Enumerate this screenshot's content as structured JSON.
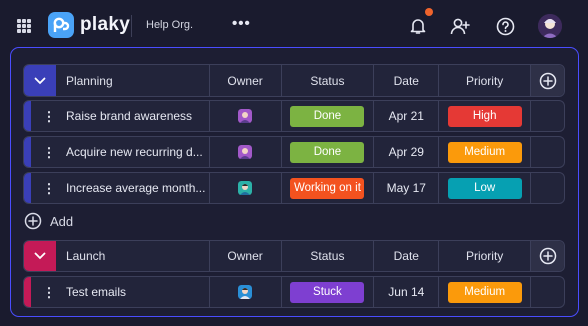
{
  "app": {
    "logo_text": "plaky",
    "org_name": "Help Org."
  },
  "top_icons": [
    "grid-icon",
    "bell-icon",
    "add-user-icon",
    "help-icon",
    "avatar"
  ],
  "groups": [
    {
      "title": "Planning",
      "color": "#3a3fb8",
      "columns": {
        "owner": "Owner",
        "status": "Status",
        "date": "Date",
        "priority": "Priority"
      },
      "tasks": [
        {
          "name": "Raise brand awareness",
          "status": "Done",
          "status_color": "#7cb342",
          "date": "Apr 21",
          "priority": "High",
          "priority_color": "#e53935",
          "owner_color": "#a259c9"
        },
        {
          "name": "Acquire new recurring d...",
          "status": "Done",
          "status_color": "#7cb342",
          "date": "Apr 29",
          "priority": "Medium",
          "priority_color": "#fb9a0b",
          "owner_color": "#a259c9"
        },
        {
          "name": "Increase average month...",
          "status": "Working on it",
          "status_color": "#f3521f",
          "date": "May 17",
          "priority": "Low",
          "priority_color": "#06a0b2",
          "owner_color": "#2cb1a8"
        }
      ]
    },
    {
      "title": "Launch",
      "color": "#c41a57",
      "columns": {
        "owner": "Owner",
        "status": "Status",
        "date": "Date",
        "priority": "Priority"
      },
      "tasks": [
        {
          "name": "Test emails",
          "status": "Stuck",
          "status_color": "#7e3fd1",
          "date": "Jun 14",
          "priority": "Medium",
          "priority_color": "#fb9a0b",
          "owner_color": "#2a8fd6"
        }
      ]
    }
  ],
  "add_label": "Add"
}
